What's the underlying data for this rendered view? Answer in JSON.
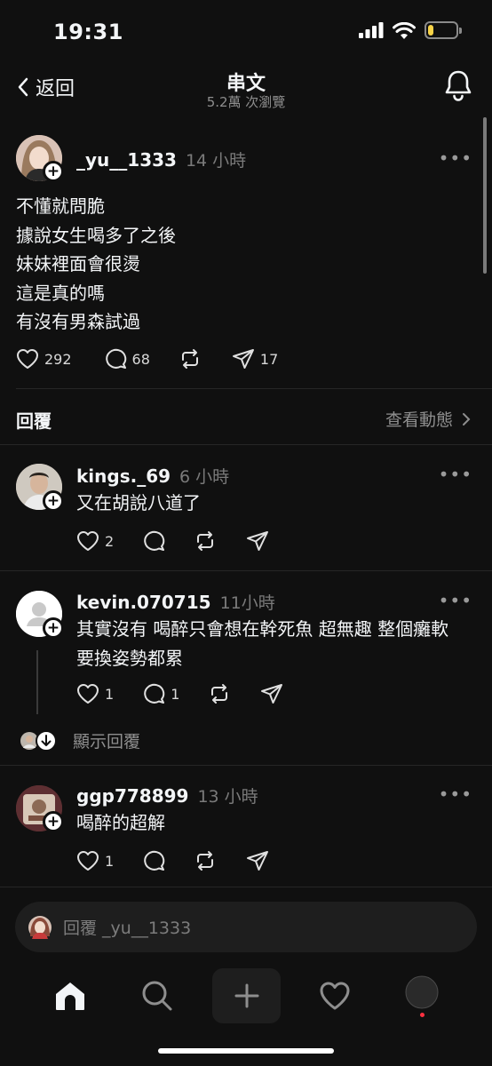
{
  "status": {
    "time": "19:31",
    "battery_level": 0.2
  },
  "nav": {
    "back_label": "返回",
    "title": "串文",
    "subtitle": "5.2萬 次瀏覽"
  },
  "post": {
    "username": "_yu__1333",
    "time": "14 小時",
    "lines": [
      "不懂就問脆",
      "據說女生喝多了之後",
      "妹妹裡面會很燙",
      "這是真的嗎",
      "有沒有男森試過"
    ],
    "likes": "292",
    "comments": "68",
    "shares": "17"
  },
  "replies_header": {
    "label": "回覆",
    "activity": "查看動態"
  },
  "replies": [
    {
      "username": "kings._69",
      "time": "6 小時",
      "text": "又在胡說八道了",
      "likes": "2",
      "comments": ""
    },
    {
      "username": "kevin.070715",
      "time": "11小時",
      "text_line1": "其實沒有 喝醉只會想在幹死魚 超無趣 整個癱軟",
      "text_line2": "要換姿勢都累",
      "likes": "1",
      "comments": "1",
      "show_replies": "顯示回覆"
    },
    {
      "username": "ggp778899",
      "time": "13 小時",
      "text": "喝醉的超解",
      "likes": "1",
      "comments": ""
    }
  ],
  "reply_input": {
    "placeholder": "回覆 _yu__1333"
  },
  "tabs": [
    "home-icon",
    "search-icon",
    "compose-icon",
    "heart-icon",
    "profile-icon"
  ],
  "colors": {
    "background": "#101010",
    "accent_battery": "#f7d348",
    "notification_dot": "#ff3040"
  }
}
